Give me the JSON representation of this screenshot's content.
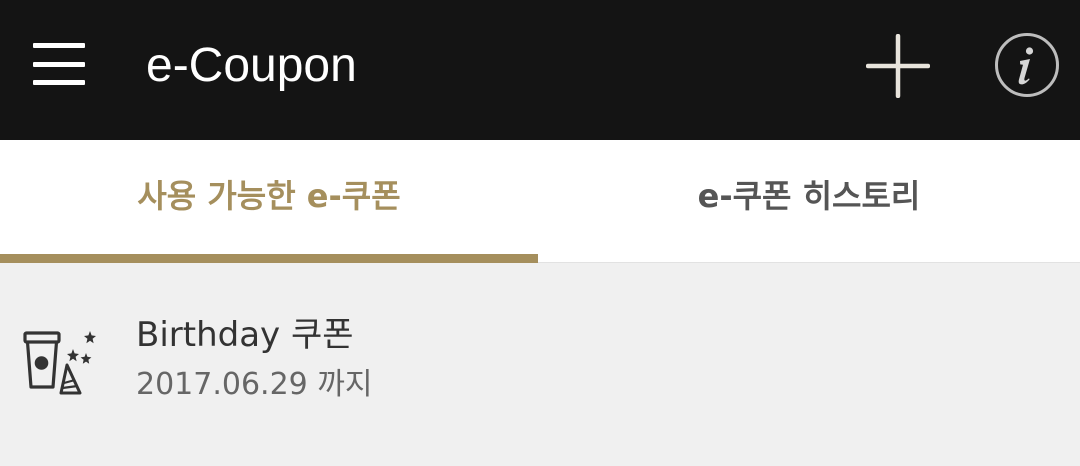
{
  "header": {
    "title": "e-Coupon",
    "icons": {
      "menu": "hamburger-menu-icon",
      "add": "plus-icon",
      "info": "info-icon"
    }
  },
  "tabs": [
    {
      "label": "사용 가능한 e-쿠폰",
      "active": true
    },
    {
      "label": "e-쿠폰 히스토리",
      "active": false
    }
  ],
  "coupons": [
    {
      "title": "Birthday 쿠폰",
      "expiry": "2017.06.29 까지",
      "icon": "birthday-cup-icon"
    }
  ],
  "colors": {
    "app_bar": "#141414",
    "accent": "#a58f5d",
    "tab_inactive": "#555555",
    "list_background": "#f0f0f0"
  }
}
